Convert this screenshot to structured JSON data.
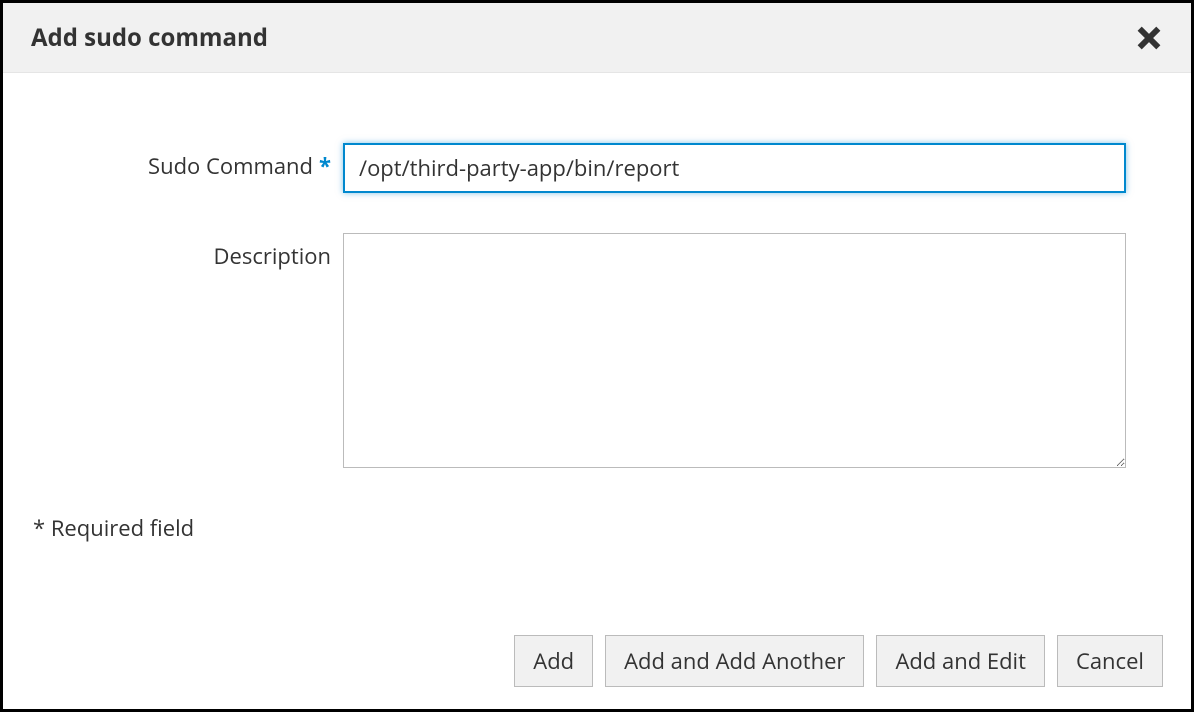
{
  "dialog": {
    "title": "Add sudo command"
  },
  "form": {
    "sudo_command": {
      "label": "Sudo Command",
      "value": "/opt/third-party-app/bin/report"
    },
    "description": {
      "label": "Description",
      "value": ""
    },
    "required_note": "* Required field"
  },
  "buttons": {
    "add": "Add",
    "add_and_add_another": "Add and Add Another",
    "add_and_edit": "Add and Edit",
    "cancel": "Cancel"
  }
}
